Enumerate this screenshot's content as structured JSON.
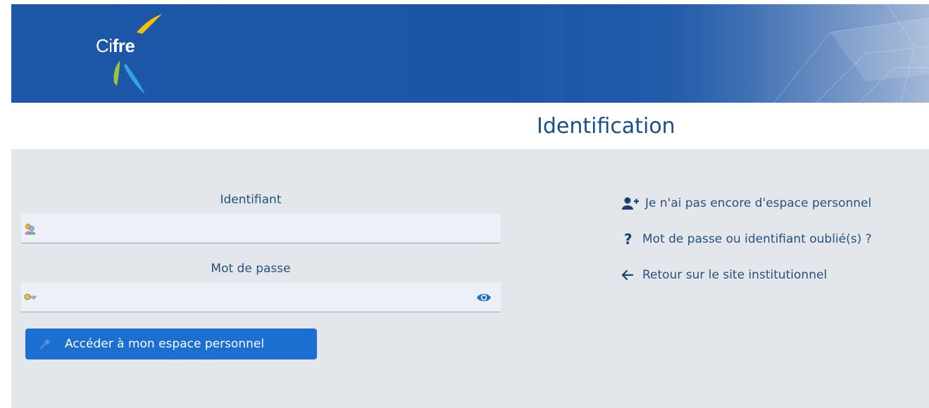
{
  "header": {
    "logo_text_light": "Ci",
    "logo_text_bold": "fre",
    "brand_color": "#1d57a8"
  },
  "page": {
    "title": "Identification"
  },
  "form": {
    "login_label": "Identifiant",
    "login_value": "",
    "login_icon": "users-icon",
    "password_label": "Mot de passe",
    "password_value": "",
    "password_icon": "key-icon",
    "toggle_icon": "eye-icon",
    "submit_label": "Accéder à mon espace personnel",
    "submit_color": "#1a6fd1"
  },
  "links": {
    "create_account": "Je n'ai pas encore d'espace personnel",
    "forgot": "Mot de passe ou identifiant oublié(s) ?",
    "back": "Retour sur le site institutionnel"
  }
}
